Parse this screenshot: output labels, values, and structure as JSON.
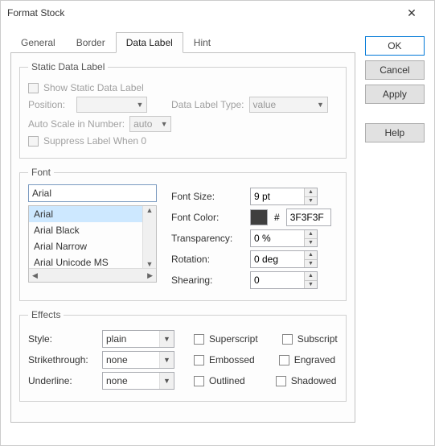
{
  "window": {
    "title": "Format Stock"
  },
  "buttons": {
    "ok": "OK",
    "cancel": "Cancel",
    "apply": "Apply",
    "help": "Help"
  },
  "tabs": {
    "general": "General",
    "border": "Border",
    "datalabel": "Data Label",
    "hint": "Hint"
  },
  "static_group": {
    "legend": "Static Data Label",
    "show": "Show Static Data Label",
    "position": "Position:",
    "type_label": "Data Label Type:",
    "type_value": "value",
    "autoscale": "Auto Scale in Number:",
    "autoscale_value": "auto",
    "suppress": "Suppress Label When 0"
  },
  "font_group": {
    "legend": "Font",
    "name": "Arial",
    "list": [
      "Arial",
      "Arial Black",
      "Arial Narrow",
      "Arial Unicode MS"
    ],
    "size_label": "Font Size:",
    "size_value": "9 pt",
    "color_label": "Font Color:",
    "color_hex": "3F3F3F",
    "trans_label": "Transparency:",
    "trans_value": "0 %",
    "rot_label": "Rotation:",
    "rot_value": "0 deg",
    "shear_label": "Shearing:",
    "shear_value": "0"
  },
  "effects_group": {
    "legend": "Effects",
    "style_label": "Style:",
    "style_value": "plain",
    "strike_label": "Strikethrough:",
    "strike_value": "none",
    "under_label": "Underline:",
    "under_value": "none",
    "superscript": "Superscript",
    "subscript": "Subscript",
    "embossed": "Embossed",
    "engraved": "Engraved",
    "outlined": "Outlined",
    "shadowed": "Shadowed"
  }
}
